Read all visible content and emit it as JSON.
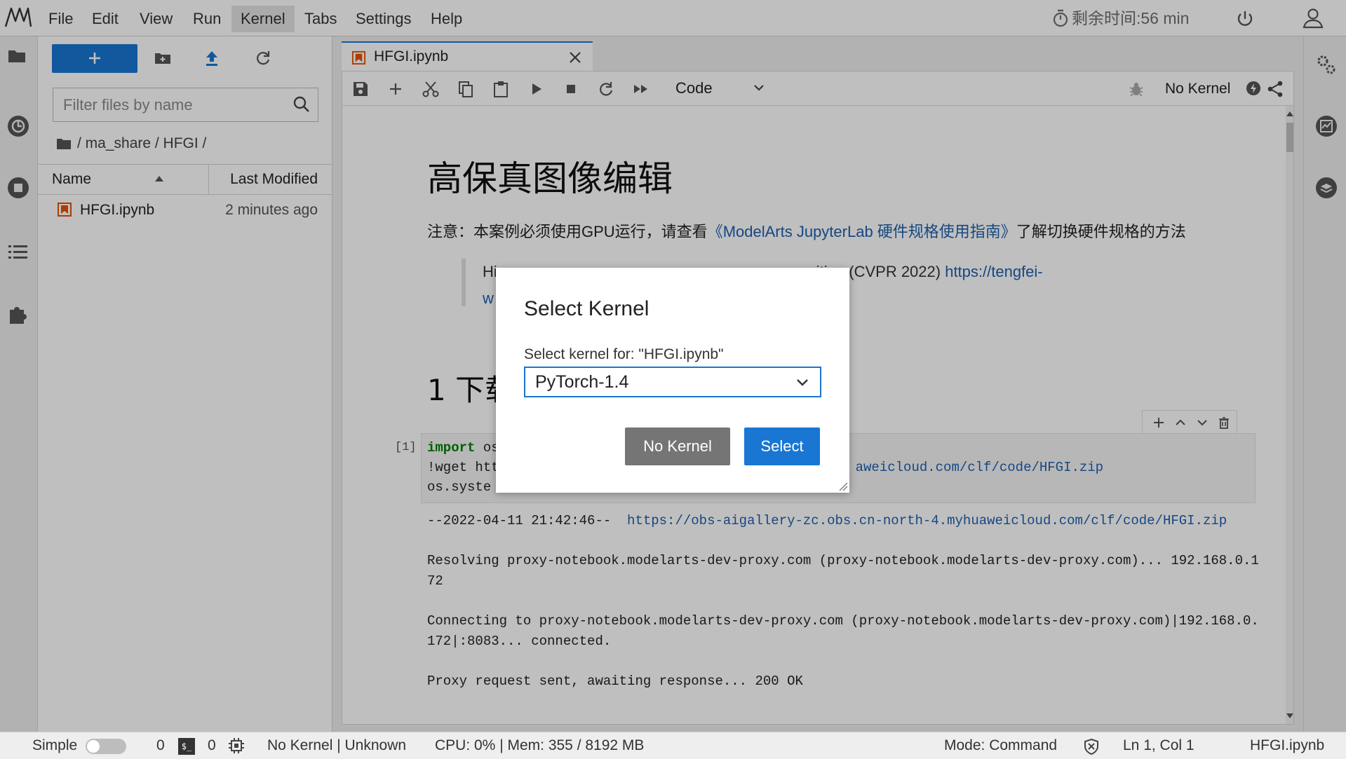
{
  "menubar": {
    "items": [
      "File",
      "Edit",
      "View",
      "Run",
      "Kernel",
      "Tabs",
      "Settings",
      "Help"
    ],
    "active_item": "Kernel",
    "timer_text": "剩余时间:56 min"
  },
  "file_browser": {
    "filter_placeholder": "Filter files by name",
    "breadcrumb": "/ ma_share / HFGI /",
    "col_name": "Name",
    "col_modified": "Last Modified",
    "files": [
      {
        "name": "HFGI.ipynb",
        "modified": "2 minutes ago"
      }
    ]
  },
  "tab": {
    "label": "HFGI.ipynb"
  },
  "toolbar": {
    "cell_type": "Code",
    "kernel_name": "No Kernel"
  },
  "notebook": {
    "title": "高保真图像编辑",
    "note_prefix": "注意：本案例必须使用GPU运行，请查看",
    "note_link": "《ModelArts JupyterLab 硬件规格使用指南》",
    "note_suffix": "了解切换硬件规格的方法",
    "quote_start": "Hi",
    "quote_mid": "iting (CVPR 2022) ",
    "quote_link": "https://tengfei-",
    "quote_line2": "w",
    "h2": "1 下载",
    "cell_prompt": "[1]",
    "code": {
      "l1_kw": "import",
      "l1": " os",
      "l2_start": "!wget htt",
      "l2_url": "aweicloud.com/clf/code/HFGI.zip",
      "l3": "os.syste"
    },
    "output": {
      "o1_prefix": "--2022-04-11 21:42:46--  ",
      "o1_url": "https://obs-aigallery-zc.obs.cn-north-4.myhuaweicloud.com/clf/code/HFGI.zip",
      "o2": "Resolving proxy-notebook.modelarts-dev-proxy.com (proxy-notebook.modelarts-dev-proxy.com)... 192.168.0.172",
      "o3": "Connecting to proxy-notebook.modelarts-dev-proxy.com (proxy-notebook.modelarts-dev-proxy.com)|192.168.0.172|:8083... connected.",
      "o4": "Proxy request sent, awaiting response... 200 OK"
    }
  },
  "dialog": {
    "title": "Select Kernel",
    "label": "Select kernel for: \"HFGI.ipynb\"",
    "selected_kernel": "PyTorch-1.4",
    "btn_no_kernel": "No Kernel",
    "btn_select": "Select"
  },
  "statusbar": {
    "simple_label": "Simple",
    "count1": "0",
    "count2": "0",
    "kernel_status": "No Kernel | Unknown",
    "resources": "CPU: 0% | Mem: 355 / 8192 MB",
    "mode": "Mode: Command",
    "position": "Ln 1, Col 1",
    "filename": "HFGI.ipynb"
  },
  "colors": {
    "accent": "#1976d2",
    "overlay": "rgba(0,0,0,0.25)",
    "button_secondary": "#757575",
    "link": "#1e5fae",
    "notebook_icon": "#e65100"
  },
  "icons": [
    "app-logo-icon",
    "timer-icon",
    "power-icon",
    "user-icon",
    "folder-icon",
    "running-icon",
    "stop-icon",
    "toc-icon",
    "extension-icon",
    "plus-icon",
    "new-folder-icon",
    "upload-icon",
    "refresh-icon",
    "search-icon",
    "sort-ascending-icon",
    "notebook-icon",
    "close-icon",
    "save-icon",
    "cut-icon",
    "copy-icon",
    "paste-icon",
    "run-icon",
    "stop-icon",
    "restart-icon",
    "fast-forward-icon",
    "chevron-down-icon",
    "bug-icon",
    "kernel-status-icon",
    "share-icon",
    "property-inspector-icon",
    "monitor-icon",
    "layers-icon",
    "terminal-icon",
    "cpu-icon",
    "shield-icon"
  ]
}
